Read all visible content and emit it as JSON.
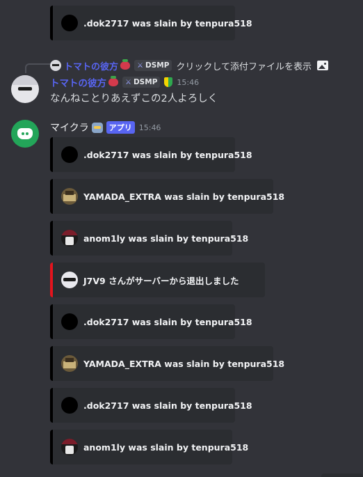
{
  "reply": {
    "username": "トマトの彼方",
    "tag": "DSMP",
    "text": "クリックして添付ファイルを表示"
  },
  "message_user": {
    "username": "トマトの彼方",
    "tag": "DSMP",
    "time": "15:46",
    "content": "なんねことりあえずこの2人よろしく"
  },
  "bot": {
    "username": "マイクラ",
    "badge": "アプリ",
    "time": "15:46"
  },
  "embeds": [
    {
      "text": ".dok2717 was slain by tenpura518"
    },
    {
      "text": ".dok2717 was slain by tenpura518"
    },
    {
      "text": "YAMADA_EXTRA was slain by tenpura518"
    },
    {
      "text": "anom1ly was slain by tenpura518"
    },
    {
      "text": "J7V9 さんがサーバーから退出しました"
    },
    {
      "text": ".dok2717 was slain by tenpura518"
    },
    {
      "text": "YAMADA_EXTRA was slain by tenpura518"
    },
    {
      "text": ".dok2717 was slain by tenpura518"
    },
    {
      "text": "anom1ly was slain by tenpura518"
    }
  ],
  "colors": {
    "background": "#323339",
    "embed_bg": "#2b2d31",
    "embed_bar_default": "#000000",
    "embed_bar_leave": "#e5141d",
    "username_accent": "#5865f2",
    "app_badge": "#5865f2",
    "discord_avatar": "#23a559"
  }
}
